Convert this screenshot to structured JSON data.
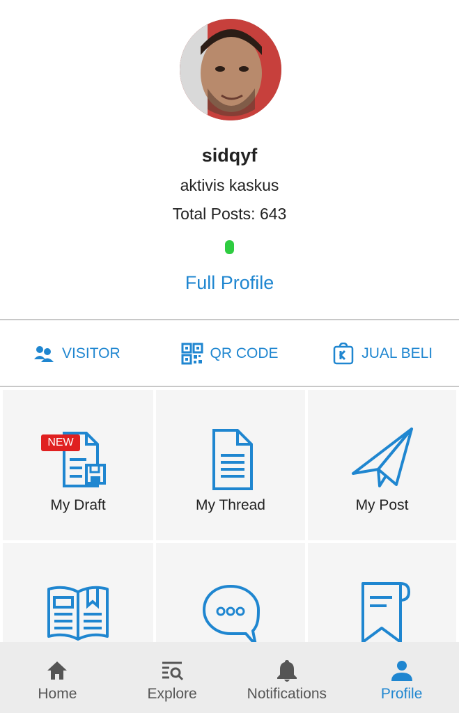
{
  "profile": {
    "username": "sidqyf",
    "rank": "aktivis kaskus",
    "total_posts": "Total Posts: 643",
    "full_profile_label": "Full Profile",
    "online_status_color": "#2ecc40"
  },
  "quick_actions": [
    {
      "label": "VISITOR",
      "icon": "visitor-icon"
    },
    {
      "label": "QR CODE",
      "icon": "qr-code-icon"
    },
    {
      "label": "JUAL BELI",
      "icon": "jual-beli-icon"
    }
  ],
  "menu": {
    "new_badge": "NEW",
    "items": [
      {
        "label": "My Draft",
        "icon": "draft-icon"
      },
      {
        "label": "My Thread",
        "icon": "thread-icon"
      },
      {
        "label": "My Post",
        "icon": "paper-plane-icon"
      },
      {
        "label": "",
        "icon": "book-icon"
      },
      {
        "label": "",
        "icon": "chat-bubble-icon"
      },
      {
        "label": "",
        "icon": "bookmark-note-icon"
      }
    ]
  },
  "bottom_nav": {
    "items": [
      {
        "label": "Home",
        "icon": "home-icon"
      },
      {
        "label": "Explore",
        "icon": "explore-icon"
      },
      {
        "label": "Notifications",
        "icon": "bell-icon"
      },
      {
        "label": "Profile",
        "icon": "person-icon",
        "active": true
      }
    ]
  },
  "colors": {
    "accent": "#1f86d0",
    "badge": "#e02020",
    "nav_bg": "#ececec",
    "cell_bg": "#f5f5f5"
  }
}
